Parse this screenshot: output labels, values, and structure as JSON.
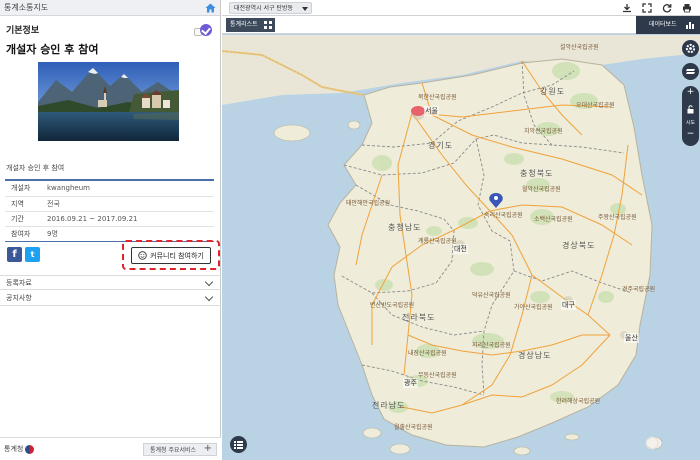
{
  "app": {
    "title": "통계소통지도"
  },
  "panel": {
    "section_title": "기본정보",
    "main_title": "개설자 승인 후 참여",
    "caption": "개설자 승인 후 참여",
    "info": [
      {
        "key": "개설자",
        "value": "kwangheum"
      },
      {
        "key": "지역",
        "value": "전국"
      },
      {
        "key": "기간",
        "value": "2016.09.21 ~ 2017.09.21"
      },
      {
        "key": "참여자",
        "value": "9명"
      }
    ],
    "social": {
      "facebook": "f",
      "twitter": "t"
    },
    "join_button": "커뮤니티 참여하기",
    "accordions": [
      "등록자료",
      "공지사항"
    ],
    "footer": {
      "logo": "통계청",
      "service_button": "통계청 주요서비스",
      "service_plus": "+"
    }
  },
  "map": {
    "location_select": "대전광역시 서구 탄방동",
    "stat_list_button": "통계리스트",
    "dashboard_button": "데이터보드",
    "zoom_in": "+",
    "zoom_out": "−",
    "zoom_level_label": "시도",
    "region_labels": [
      "강원도",
      "경기도",
      "충청북도",
      "충청남도",
      "경상북도",
      "전라북도",
      "경상남도",
      "전라남도"
    ],
    "city_labels": [
      "서울",
      "대전",
      "대구",
      "광주",
      "울산"
    ],
    "park_labels": [
      "설악산국립공원",
      "오대산국립공원",
      "치악산국립공원",
      "속리산국립공원",
      "월악산국립공원",
      "소백산국립공원",
      "계룡산국립공원",
      "덕유산국립공원",
      "가야산국립공원",
      "지리산국립공원",
      "주왕산국립공원",
      "내장산국립공원",
      "월출산국립공원",
      "무등산국립공원",
      "태안해안국립공원",
      "변산반도국립공원",
      "한려해상국립공원",
      "경주국립공원",
      "북한산국립공원"
    ]
  },
  "colors": {
    "accent_dark": "#2e3a4c",
    "join_highlight": "#e0242c",
    "table_rule": "#4b72a8",
    "marker": "#e8626b",
    "location_pin": "#3a57b8",
    "sea": "#b9d2e4",
    "land": "#efecd9"
  },
  "icons": [
    "home-icon",
    "share-icon",
    "download-icon",
    "fullscreen-icon",
    "refresh-icon",
    "print-icon",
    "settings-icon",
    "layers-icon",
    "lock-icon",
    "legend-icon",
    "location-pin-icon",
    "smile-icon"
  ]
}
